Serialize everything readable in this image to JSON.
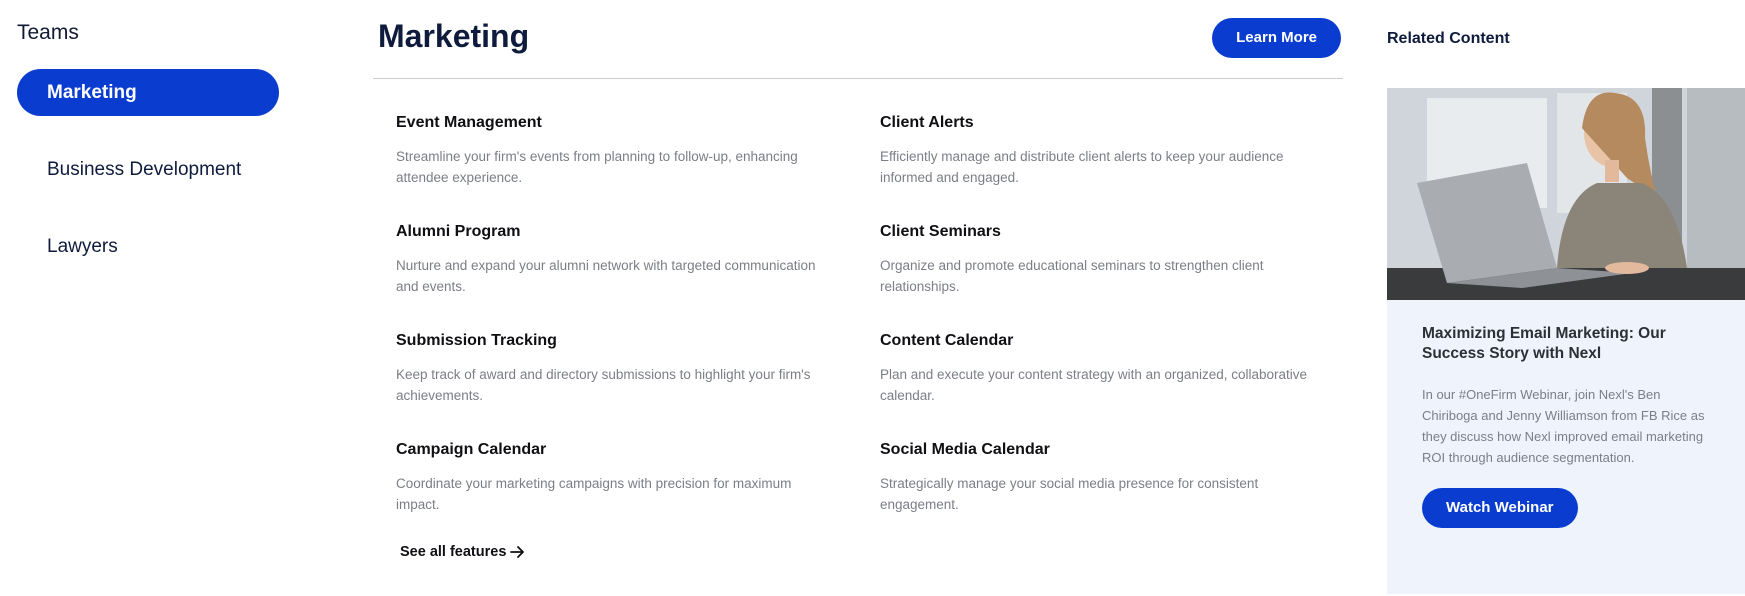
{
  "sidebar": {
    "title": "Teams",
    "items": [
      {
        "label": "Marketing",
        "active": true
      },
      {
        "label": "Business Development",
        "active": false
      },
      {
        "label": "Lawyers",
        "active": false
      }
    ]
  },
  "main": {
    "title": "Marketing",
    "learn_more_label": "Learn More",
    "features": [
      {
        "title": "Event Management",
        "desc": "Streamline your firm's events from planning to follow-up, enhancing attendee experience."
      },
      {
        "title": "Client Alerts",
        "desc": "Efficiently manage and distribute client alerts to keep your audience informed and engaged."
      },
      {
        "title": "Alumni Program",
        "desc": "Nurture and expand your alumni network with targeted communication and events."
      },
      {
        "title": "Client Seminars",
        "desc": "Organize and promote educational seminars to strengthen client relationships."
      },
      {
        "title": "Submission Tracking",
        "desc": "Keep track of award and directory submissions to highlight your firm's achievements."
      },
      {
        "title": "Content Calendar",
        "desc": "Plan and execute your content strategy with an organized, collaborative calendar."
      },
      {
        "title": "Campaign Calendar",
        "desc": "Coordinate your marketing campaigns with precision for maximum impact."
      },
      {
        "title": "Social Media Calendar",
        "desc": "Strategically manage your social media presence for consistent engagement."
      }
    ],
    "see_all_label": "See all features",
    "see_all_icon": "arrow-right-icon"
  },
  "related": {
    "title": "Related Content",
    "card": {
      "image": "woman-with-laptop-photo",
      "title": "Maximizing Email Marketing: Our Success Story with Nexl",
      "desc": "In our #OneFirm Webinar, join Nexl's Ben Chiriboga and Jenny Williamson from FB Rice as they discuss how Nexl improved email marketing ROI through audience segmentation.",
      "button_label": "Watch Webinar"
    }
  },
  "colors": {
    "accent": "#0a3ccf",
    "card_bg": "#eff4fc",
    "text_dark": "#0f1b3d",
    "text_muted": "#7b7e86"
  }
}
